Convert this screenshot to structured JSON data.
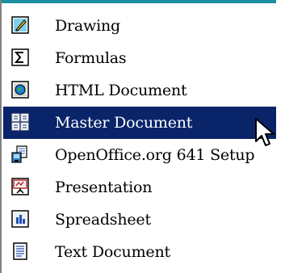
{
  "menu": {
    "items": [
      {
        "label": "Drawing",
        "icon": "drawing-icon"
      },
      {
        "label": "Formulas",
        "icon": "formulas-icon"
      },
      {
        "label": "HTML Document",
        "icon": "html-document-icon"
      },
      {
        "label": "Master Document",
        "icon": "master-document-icon",
        "selected": true
      },
      {
        "label": "OpenOffice.org 641 Setup",
        "icon": "setup-icon"
      },
      {
        "label": "Presentation",
        "icon": "presentation-icon"
      },
      {
        "label": "Spreadsheet",
        "icon": "spreadsheet-icon"
      },
      {
        "label": "Text Document",
        "icon": "text-document-icon"
      }
    ]
  },
  "colors": {
    "selection": "#0a246a",
    "accent_strip": "#1a8fa0"
  }
}
